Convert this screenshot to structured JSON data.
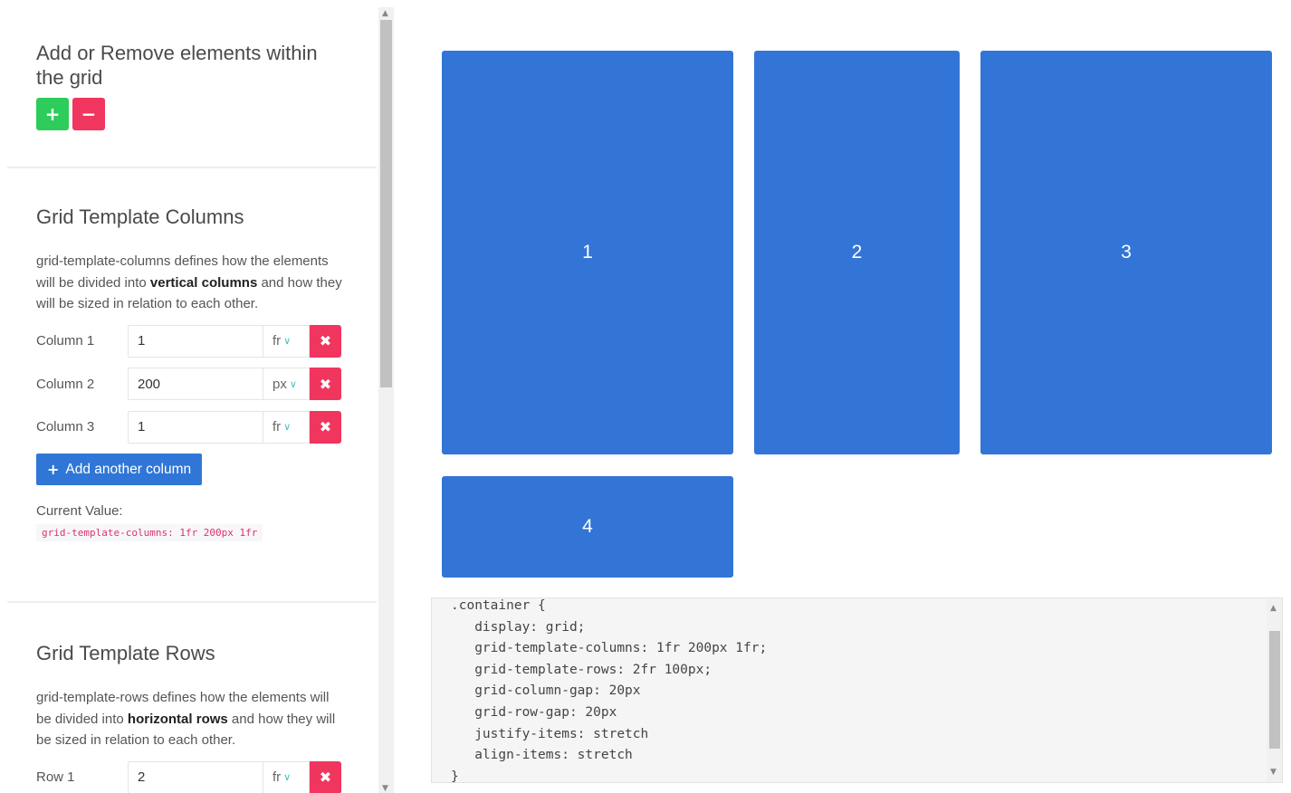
{
  "elements_section": {
    "title": "Add or Remove elements within the grid",
    "add_icon": "plus-icon",
    "remove_icon": "minus-icon",
    "add_glyph": "+",
    "remove_glyph": "−"
  },
  "columns_section": {
    "title": "Grid Template Columns",
    "desc_pre": "grid-template-columns defines how the elements will be divided into ",
    "desc_bold": "vertical columns",
    "desc_post": " and how they will be sized in relation to each other.",
    "columns": [
      {
        "label": "Column 1",
        "value": "1",
        "unit": "fr"
      },
      {
        "label": "Column 2",
        "value": "200",
        "unit": "px"
      },
      {
        "label": "Column 3",
        "value": "1",
        "unit": "fr"
      }
    ],
    "add_button": "Add another column",
    "current_label": "Current Value:",
    "current_value": "grid-template-columns: 1fr 200px 1fr"
  },
  "rows_section": {
    "title": "Grid Template Rows",
    "desc_pre": "grid-template-rows defines how the elements will be divided into ",
    "desc_bold": "horizontal rows",
    "desc_post": " and how they will be sized in relation to each other.",
    "rows": [
      {
        "label": "Row 1",
        "value": "2",
        "unit": "fr"
      }
    ]
  },
  "grid_preview": {
    "items": [
      "1",
      "2",
      "3",
      "4"
    ],
    "color": "#3375d6"
  },
  "css_code": {
    "lines": [
      ".container {",
      "   display: grid;",
      "   grid-template-columns: 1fr 200px 1fr;",
      "   grid-template-rows: 2fr 100px;",
      "   grid-column-gap: 20px",
      "   grid-row-gap: 20px",
      "   justify-items: stretch",
      "   align-items: stretch",
      "}"
    ]
  },
  "colors": {
    "add_green": "#2ecc5a",
    "remove_red": "#f0365e",
    "primary_blue": "#2f76d6",
    "chevron_teal": "#3fc1c9"
  }
}
